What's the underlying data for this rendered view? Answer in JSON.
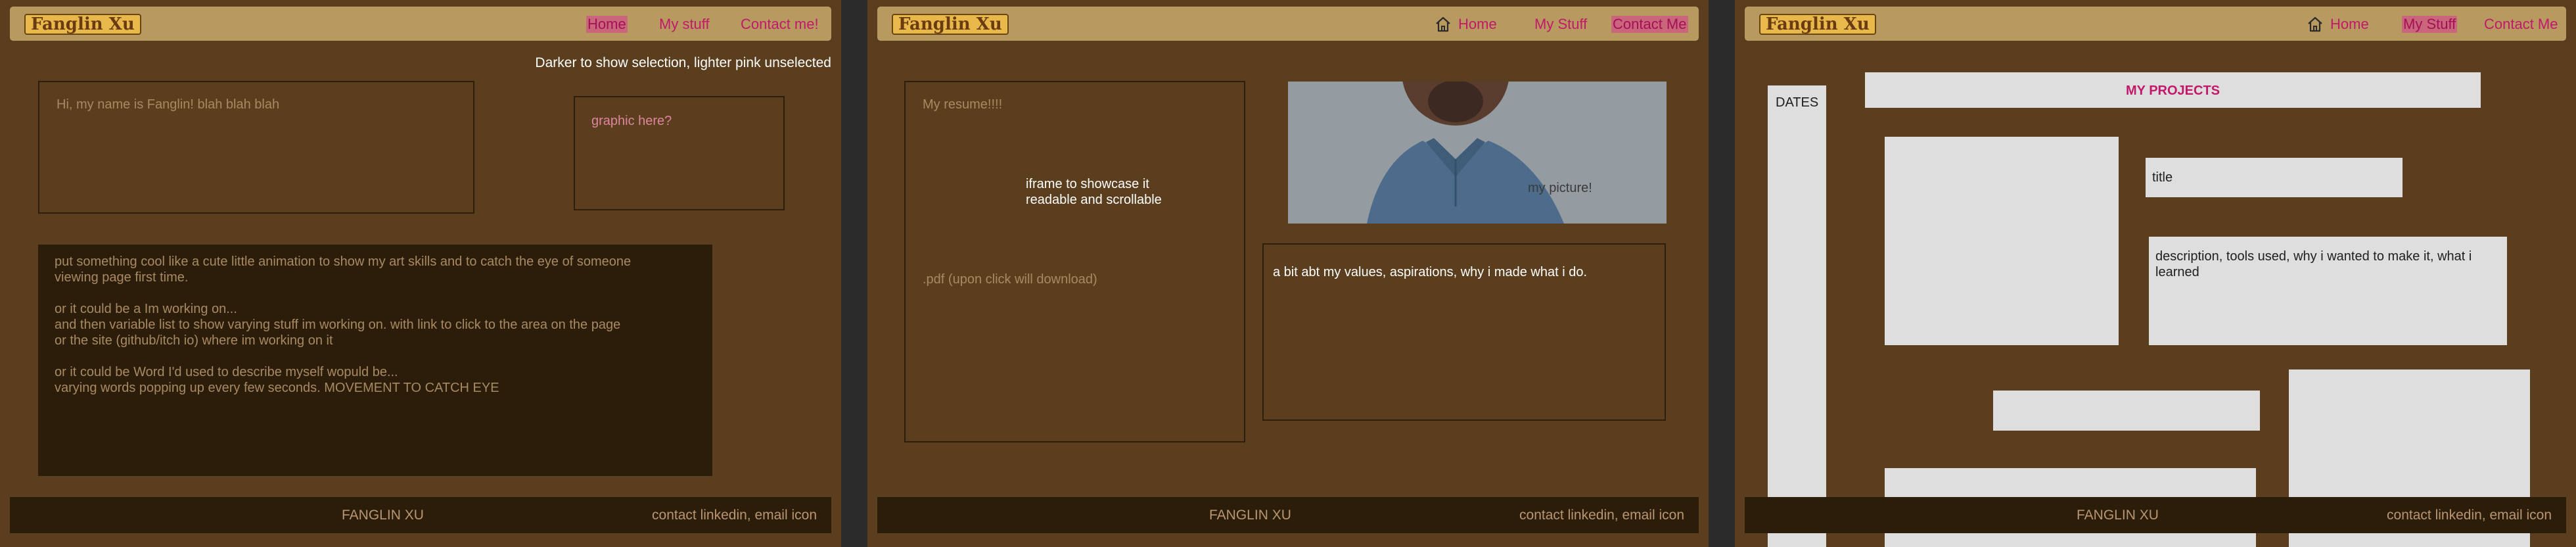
{
  "logo_text": "Fanglin Xu",
  "footer": {
    "name": "FANGLIN XU",
    "contact": "contact linkedin, email icon"
  },
  "page1": {
    "nav": {
      "home": "Home",
      "mystuff": "My stuff",
      "contact": "Contact me!"
    },
    "note": "Darker to show selection, lighter pink unselected",
    "intro": "Hi, my name is Fanglin! blah blah blah",
    "graphic": "graphic here?",
    "animation_lines": [
      "put something cool like a cute little animation to show my art skills and to catch the eye of someone",
      "viewing page first time.",
      "",
      "or it could be a Im working on...",
      "and then variable list to show varying stuff im working on. with link to click to the area on the page",
      "or the site (github/itch io) where im working on it",
      "",
      "or it could be Word I'd used to describe myself wopuld be...",
      "varying words popping up every few seconds. MOVEMENT TO CATCH EYE"
    ]
  },
  "page2": {
    "nav": {
      "home": "Home",
      "mystuff": "My Stuff",
      "contact": "Contact Me"
    },
    "resume_title": "My resume!!!!",
    "iframe_note": "iframe to showcase it readable and scrollable",
    "pdf_note": ".pdf (upon click will download)",
    "photo_caption": "my picture!",
    "values": "a bit abt my values, aspirations, why i made what i do."
  },
  "page3": {
    "nav": {
      "home": "Home",
      "mystuff": "My Stuff",
      "contact": "Contact Me"
    },
    "dates": "DATES",
    "projects_title": "MY PROJECTS",
    "project_title": "title",
    "project_desc": "description, tools used, why i wanted to make it, what i learned"
  },
  "colors": {
    "background": "#5a3e1d",
    "navbar": "#b89a60",
    "nav_link": "#c2186b",
    "footer": "#2c1d0b"
  }
}
